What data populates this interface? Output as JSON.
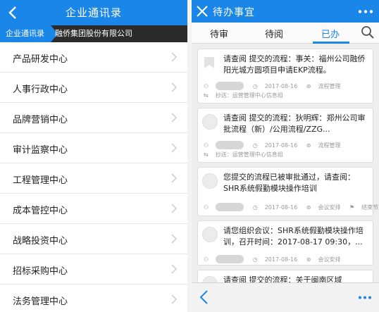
{
  "left": {
    "header": {
      "title": "企业通讯录"
    },
    "breadcrumb": {
      "root": "企业通讯录",
      "current": "融侨集团股份有限公司"
    },
    "departments": [
      "产品研发中心",
      "人事行政中心",
      "品牌营销中心",
      "审计监察中心",
      "工程管理中心",
      "成本管控中心",
      "战略投资中心",
      "招标采购中心",
      "法务管理中心"
    ]
  },
  "right": {
    "header": {
      "title": "待办事宜"
    },
    "tabs": {
      "pending_review": "待审",
      "pending_read": "待阅",
      "done": "已办",
      "active": "done"
    },
    "cards": [
      {
        "text": "请查阅 提交的流程：事关：福州公司融侨阳光城方圆项目申请EKP流程。",
        "date": "2017-08-16",
        "tag": "流程管理",
        "cc": "抄送：运营管理中心信息组"
      },
      {
        "text": "请查阅 提交的流程：狄明辉：郑州公司审批流程（新）/公用流程/ZZG...",
        "date": "2017-08-16",
        "tag": "流程管理",
        "cc": "抄送：运营管理中心信息组"
      },
      {
        "text": "您提交的流程已被审批通过，请查阅：SHR系统假勤模块操作培训",
        "date": "2017-08-16",
        "tag": "会议安排",
        "tag2": "结束节点"
      },
      {
        "text": "请您组织会议：SHR系统假勤模块操作培训，召开时间：2017-08-17 09:30，...",
        "date": "2017-08-16",
        "tag": "会议安排"
      },
      {
        "text": "请查阅 提交的流程：关于闽南区域"
      }
    ]
  },
  "colors": {
    "brand": "#1a86e8",
    "crumb_bg": "#2b2b2b"
  }
}
